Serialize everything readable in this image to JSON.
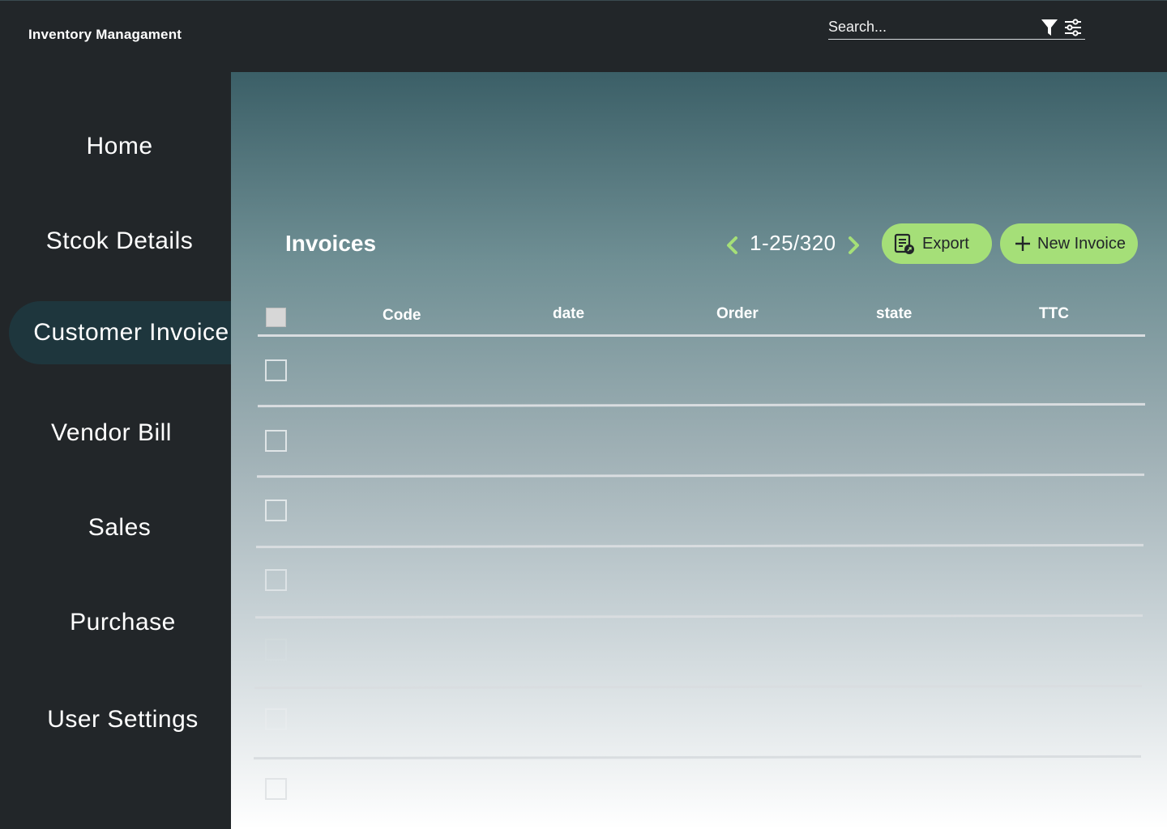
{
  "app": {
    "title": "Inventory Managament"
  },
  "search": {
    "placeholder": "Search..."
  },
  "icons": {
    "filter": "filter-icon",
    "settings": "sliders-icon"
  },
  "sidebar": {
    "items": [
      {
        "label": "Home",
        "active": false
      },
      {
        "label": "Stcok Details",
        "active": false
      },
      {
        "label": "Customer Invoice",
        "active": true
      },
      {
        "label": "Vendor Bill",
        "active": false
      },
      {
        "label": "Sales",
        "active": false
      },
      {
        "label": "Purchase",
        "active": false
      },
      {
        "label": "User Settings",
        "active": false
      }
    ]
  },
  "main": {
    "title": "Invoices",
    "pagination": {
      "text": "1-25/320",
      "range_start": 1,
      "range_end": 25,
      "total": 320
    },
    "export_label": "Export",
    "new_invoice_label": "New Invoice",
    "table": {
      "headers": [
        "Code",
        "date",
        "Order",
        "state",
        "TTC"
      ],
      "row_count": 7
    }
  },
  "colors": {
    "sidebar_bg": "#222629",
    "active_item_bg": "#1e363d",
    "accent_green": "#a5df78",
    "chevron_green": "#a5df78"
  }
}
